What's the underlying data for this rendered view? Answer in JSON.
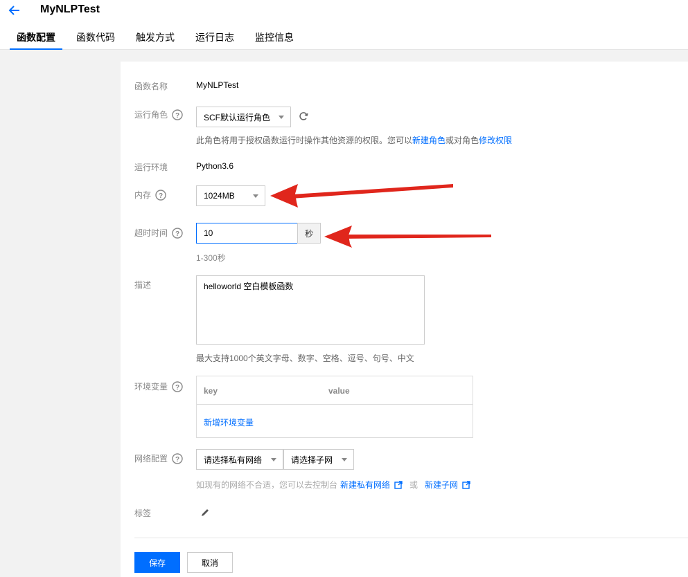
{
  "header": {
    "title": "MyNLPTest",
    "tabs": [
      {
        "label": "函数配置"
      },
      {
        "label": "函数代码"
      },
      {
        "label": "触发方式"
      },
      {
        "label": "运行日志"
      },
      {
        "label": "监控信息"
      }
    ]
  },
  "form": {
    "func_name": {
      "label": "函数名称",
      "value": "MyNLPTest"
    },
    "role": {
      "label": "运行角色",
      "selected": "SCF默认运行角色",
      "hint_prefix": "此角色将用于授权函数运行时操作其他资源的权限。您可以",
      "hint_link1": "新建角色",
      "hint_mid": "或对角色",
      "hint_link2": "修改权限"
    },
    "runtime": {
      "label": "运行环境",
      "value": "Python3.6"
    },
    "memory": {
      "label": "内存",
      "selected": "1024MB"
    },
    "timeout": {
      "label": "超时时间",
      "value": "10",
      "unit": "秒",
      "hint": "1-300秒"
    },
    "description": {
      "label": "描述",
      "value": "helloworld 空白模板函数",
      "hint": "最大支持1000个英文字母、数字、空格、逗号、句号、中文"
    },
    "env": {
      "label": "环境变量",
      "col_key": "key",
      "col_value": "value",
      "add_link": "新增环境变量"
    },
    "network": {
      "label": "网络配置",
      "vpc_placeholder": "请选择私有网络",
      "subnet_placeholder": "请选择子网",
      "hint_prefix": "如现有的网络不合适，您可以去控制台",
      "link_vpc": "新建私有网络",
      "hint_or": "或",
      "link_subnet": "新建子网"
    },
    "tags": {
      "label": "标签"
    }
  },
  "actions": {
    "save": "保存",
    "cancel": "取消"
  },
  "colors": {
    "accent": "#006eff",
    "arrow": "#e0261c"
  }
}
